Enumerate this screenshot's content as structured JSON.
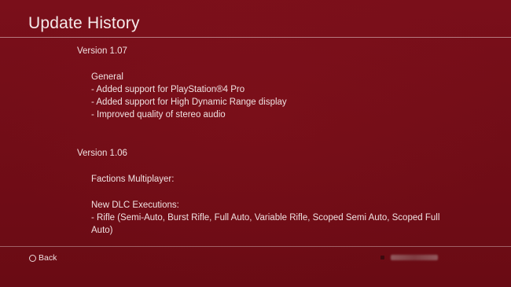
{
  "header": {
    "title": "Update History"
  },
  "history": {
    "v107": {
      "version": "Version 1.07",
      "section": "General",
      "items": [
        "- Added support for PlayStation®4 Pro",
        "- Added support for High Dynamic Range display",
        "- Improved quality of stereo audio"
      ]
    },
    "v106": {
      "version": "Version 1.06",
      "section": "Factions Multiplayer:",
      "subsection": "New DLC Executions:",
      "items": [
        "- Rifle (Semi-Auto, Burst Rifle, Full Auto, Variable Rifle, Scoped Semi Auto, Scoped Full",
        "Auto)"
      ]
    }
  },
  "footer": {
    "back_label": "Back",
    "back_icon": "circle-button-icon",
    "user_icon": "user-status-icon"
  },
  "colors": {
    "background": "#760e18",
    "text": "#f0e2e2",
    "rule": "#ffffff"
  }
}
